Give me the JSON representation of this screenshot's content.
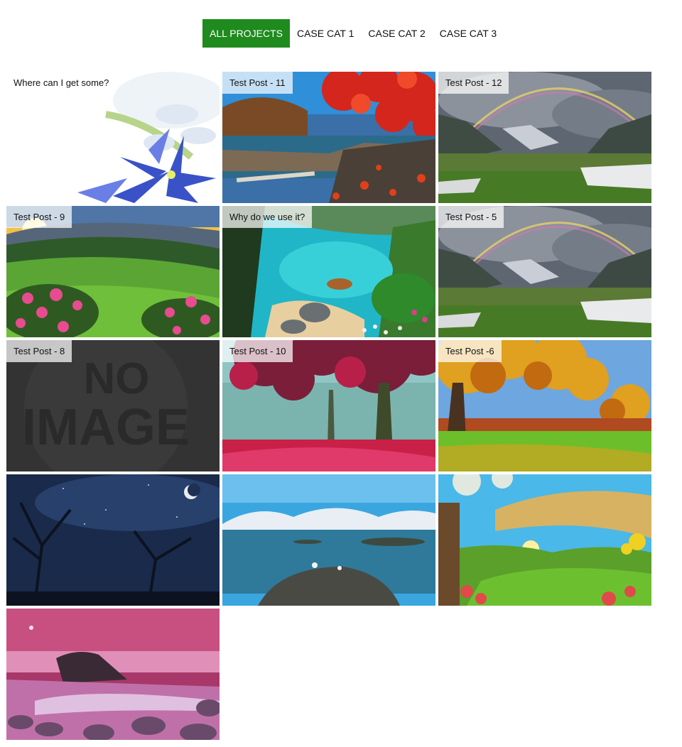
{
  "filters": [
    {
      "label": "ALL PROJECTS",
      "active": true
    },
    {
      "label": "CASE CAT 1",
      "active": false
    },
    {
      "label": "CASE CAT 2",
      "active": false
    },
    {
      "label": "CASE CAT 3",
      "active": false
    }
  ],
  "colors": {
    "accent": "#1f8a1d"
  },
  "portfolio": {
    "items": [
      {
        "title": "Where can I get some?",
        "scene": "flowers"
      },
      {
        "title": "Test Post - 11",
        "scene": "autumn-lake"
      },
      {
        "title": "Test Post - 12",
        "scene": "rainbow-valley"
      },
      {
        "title": "Test Post - 9",
        "scene": "sunset-meadow"
      },
      {
        "title": "Why do we use it?",
        "scene": "tropical-cove"
      },
      {
        "title": "Test Post - 5",
        "scene": "rainbow-valley"
      },
      {
        "title": "Test Post - 8",
        "scene": "no-image",
        "placeholder_text": [
          "NO",
          "IMAGE"
        ]
      },
      {
        "title": "Test Post - 10",
        "scene": "red-forest"
      },
      {
        "title": "Test Post -6",
        "scene": "autumn-park"
      },
      {
        "title": "",
        "scene": "night-moon"
      },
      {
        "title": "",
        "scene": "fjord"
      },
      {
        "title": "",
        "scene": "fantasy-hills"
      },
      {
        "title": "",
        "scene": "pink-beach"
      }
    ]
  }
}
